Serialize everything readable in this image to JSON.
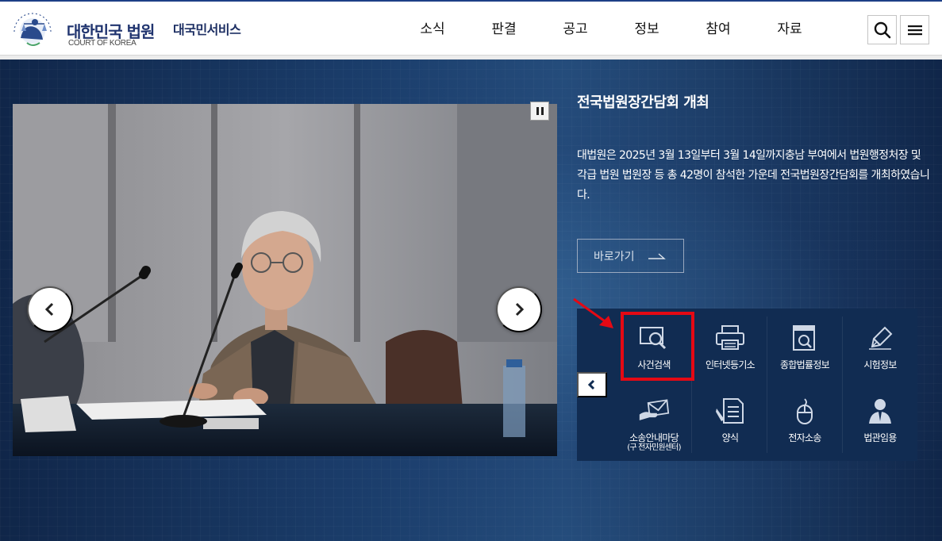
{
  "header": {
    "brand_name": "대한민국 법원",
    "brand_sub": "COURT OF KOREA",
    "service_name": "대국민서비스",
    "nav": [
      {
        "label": "소식"
      },
      {
        "label": "판결"
      },
      {
        "label": "공고"
      },
      {
        "label": "정보"
      },
      {
        "label": "참여"
      },
      {
        "label": "자료"
      }
    ],
    "search_icon": "search-icon",
    "menu_icon": "hamburger-menu-icon"
  },
  "slide": {
    "title": "전국법원장간담회 개최",
    "body": "대법원은 2025년 3월 13일부터 3월 14일까지충남 부여에서 법원행정처장 및 각급 법원 법원장 등 총 42명이 참석한 가운데 전국법원장간담회를 개최하였습니다.",
    "go_label": "바로가기"
  },
  "quick_menu": {
    "items": [
      {
        "label": "사건검색",
        "icon": "case-search-icon"
      },
      {
        "label": "인터넷등기소",
        "icon": "printer-icon"
      },
      {
        "label": "종합법률정보",
        "icon": "law-info-icon"
      },
      {
        "label": "시험정보",
        "icon": "pen-icon"
      },
      {
        "label": "소송안내마당",
        "sub": "(구 전자민원센터)",
        "icon": "envelope-hand-icon"
      },
      {
        "label": "양식",
        "icon": "form-icon"
      },
      {
        "label": "전자소송",
        "icon": "mouse-icon"
      },
      {
        "label": "법관임용",
        "icon": "judge-icon"
      }
    ]
  },
  "colors": {
    "brand": "#20346f",
    "background": "#0f2347",
    "quick_menu_bg": "#112c52",
    "highlight": "#e50914"
  }
}
